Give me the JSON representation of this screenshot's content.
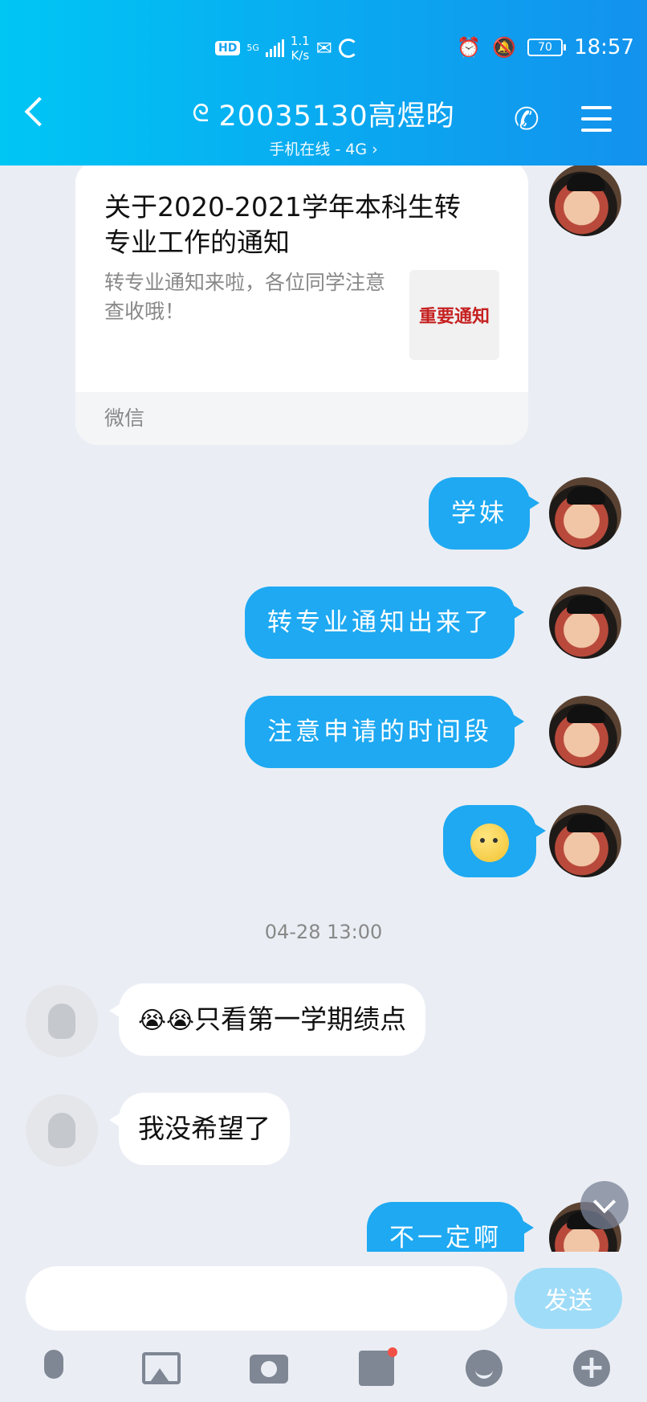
{
  "status_bar": {
    "hd": "HD",
    "net": "5G",
    "speed_value": "1.1",
    "speed_unit": "K/s",
    "battery": "70",
    "time": "18:57"
  },
  "header": {
    "title": "20035130高煜昀",
    "subtitle": "手机在线 - 4G ›"
  },
  "card": {
    "title": "关于2020-2021学年本科生转专业工作的通知",
    "description": "转专业通知来啦，各位同学注意查收哦！",
    "thumb_text": "重要通知",
    "source": "微信"
  },
  "messages_out": {
    "m1": "学妹",
    "m2": "转专业通知出来了",
    "m3": "注意申请的时间段",
    "m5": "不一定啊"
  },
  "time_separator": "04-28 13:00",
  "messages_in": {
    "m1_emoji": "😭😭",
    "m1_text": "只看第一学期绩点",
    "m2": "我没希望了"
  },
  "input": {
    "value": "",
    "send_label": "发送"
  },
  "colors": {
    "header_start": "#00c6f4",
    "header_end": "#1392ee",
    "bubble_out": "#1ea9f2",
    "send_disabled": "#9fdcf8"
  },
  "icons": [
    "back-icon",
    "ear-icon",
    "phone-icon",
    "menu-icon",
    "mic-icon",
    "image-icon",
    "camera-icon",
    "red-packet-icon",
    "emoji-icon",
    "plus-icon",
    "chevron-down-icon"
  ]
}
